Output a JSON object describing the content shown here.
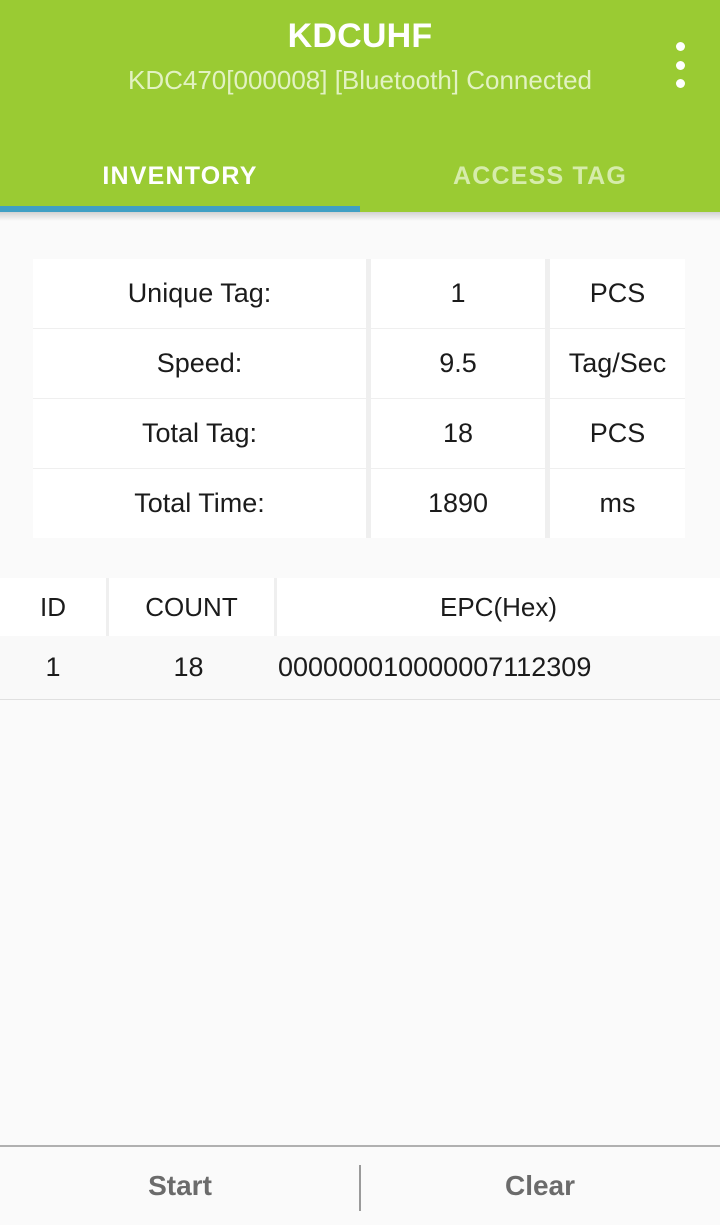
{
  "appbar": {
    "title": "KDCUHF",
    "subtitle": "KDC470[000008] [Bluetooth] Connected",
    "overflow_icon": "more-vert-icon",
    "background_color": "#9acb33",
    "title_color": "#ffffff",
    "subtitle_color": "#e2f2c2"
  },
  "tabs": {
    "indicator_color": "#3f9fc4",
    "active_index": 0,
    "items": [
      {
        "label": "INVENTORY",
        "active": true
      },
      {
        "label": "ACCESS TAG",
        "active": false
      }
    ]
  },
  "info_table": {
    "rows": [
      {
        "label": "Unique Tag:",
        "value": "1",
        "unit": "PCS"
      },
      {
        "label": "Speed:",
        "value": "9.5",
        "unit": "Tag/Sec"
      },
      {
        "label": "Total Tag:",
        "value": "18",
        "unit": "PCS"
      },
      {
        "label": "Total Time:",
        "value": "1890",
        "unit": "ms"
      }
    ]
  },
  "epc_table": {
    "headers": {
      "id": "ID",
      "count": "COUNT",
      "epc": "EPC(Hex)"
    },
    "rows": [
      {
        "id": "1",
        "count": "18",
        "epc": "000000010000007112309"
      }
    ]
  },
  "bottom_bar": {
    "start_label": "Start",
    "clear_label": "Clear"
  }
}
